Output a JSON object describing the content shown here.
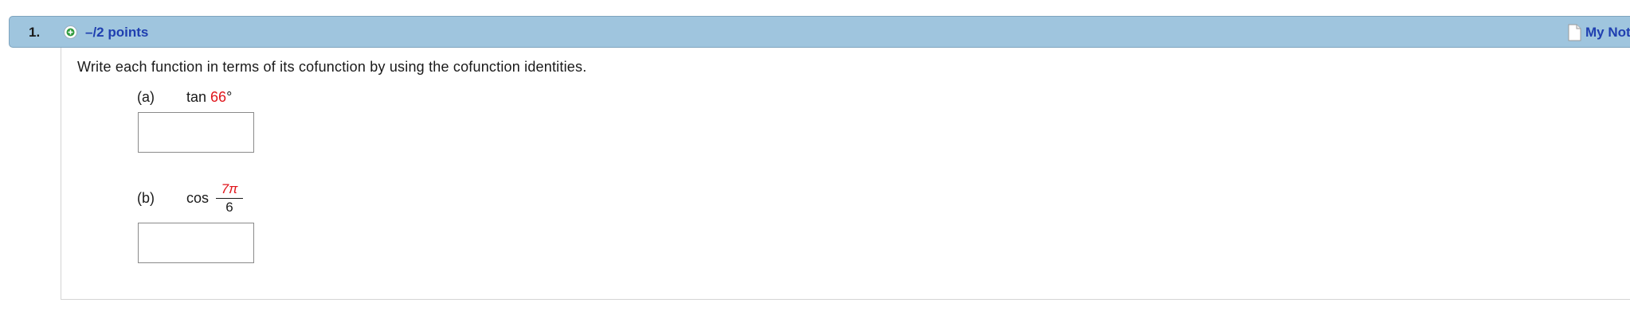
{
  "header": {
    "number": "1.",
    "points": "–/2 points",
    "notes_label": "My Notes"
  },
  "question": {
    "prompt": "Write each function in terms of its cofunction by using the cofunction identities.",
    "parts": [
      {
        "label": "(a)",
        "function": "tan",
        "argument_value": "66",
        "argument_unit": "°",
        "answer_value": ""
      },
      {
        "label": "(b)",
        "function": "cos",
        "numerator": "7π",
        "denominator": "6",
        "answer_value": ""
      }
    ]
  },
  "colors": {
    "header_bg": "#9fc5de",
    "link": "#1f3fb0",
    "highlight": "#e0151b"
  },
  "icons": [
    "expand-plus-icon",
    "note-page-icon"
  ]
}
